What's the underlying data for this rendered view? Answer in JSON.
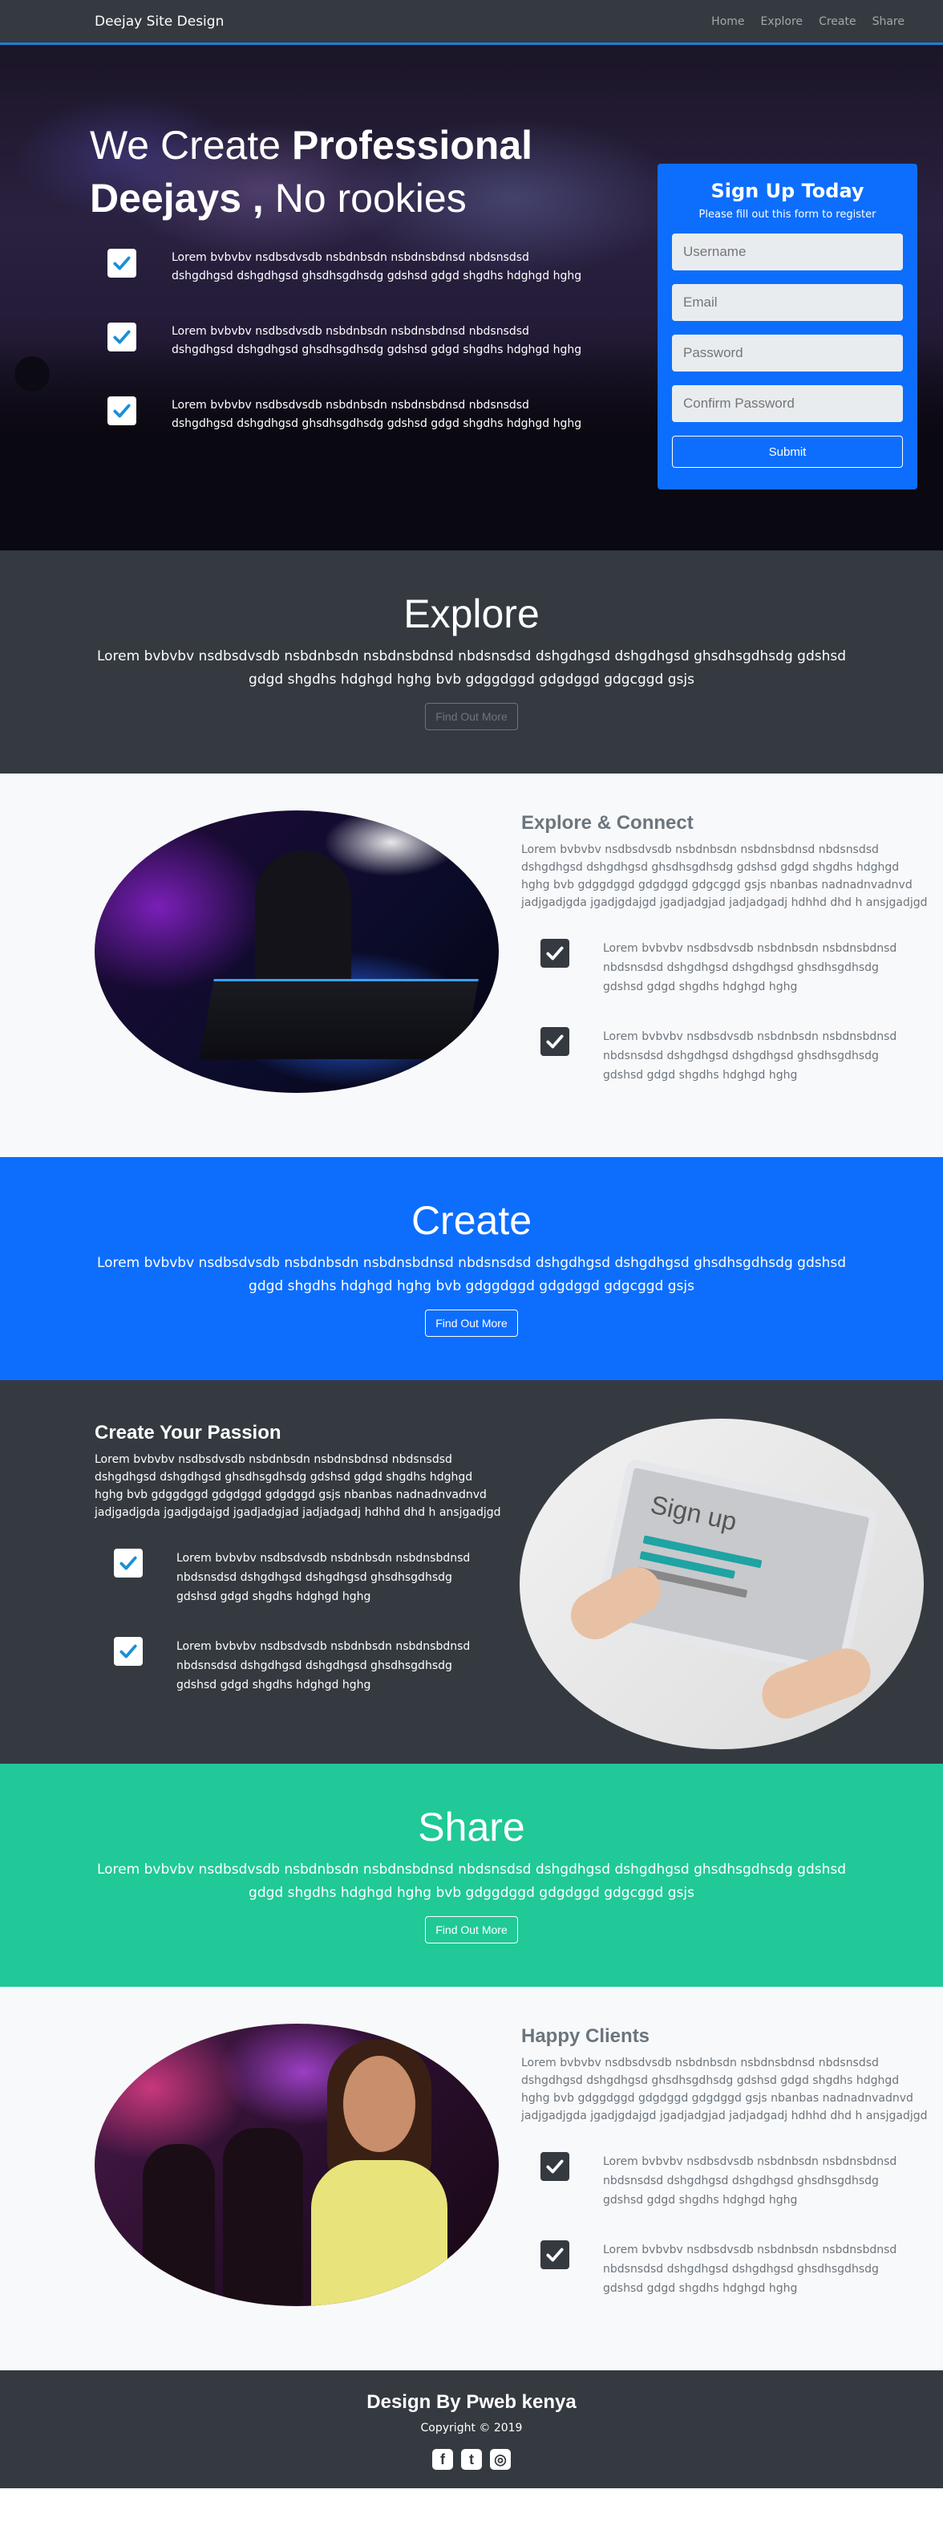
{
  "navbar": {
    "brand": "Deejay Site Design",
    "links": [
      "Home",
      "Explore",
      "Create",
      "Share"
    ]
  },
  "hero": {
    "title_light1": "We Create ",
    "title_bold1": "Professional",
    "title_bold2": "Deejays ,",
    "title_light2": " No rookies",
    "features": [
      "Lorem bvbvbv nsdbsdvsdb nsbdnbsdn nsbdnsbdnsd nbdsnsdsd dshgdhgsd dshgdhgsd ghsdhsgdhsdg gdshsd gdgd shgdhs hdghgd hghg",
      "Lorem bvbvbv nsdbsdvsdb nsbdnbsdn nsbdnsbdnsd nbdsnsdsd dshgdhgsd dshgdhgsd ghsdhsgdhsdg gdshsd gdgd shgdhs hdghgd hghg",
      "Lorem bvbvbv nsdbsdvsdb nsbdnbsdn nsbdnsbdnsd nbdsnsdsd dshgdhgsd dshgdhgsd ghsdhsgdhsdg gdshsd gdgd shgdhs hdghgd hghg"
    ],
    "signup": {
      "title": "Sign Up Today",
      "subtitle": "Please fill out this form to register",
      "username_placeholder": "Username",
      "email_placeholder": "Email",
      "password_placeholder": "Password",
      "confirm_placeholder": "Confirm Password",
      "submit_label": "Submit"
    }
  },
  "explore": {
    "title": "Explore",
    "text": "Lorem bvbvbv nsdbsdvsdb nsbdnbsdn nsbdnsbdnsd nbdsnsdsd dshgdhgsd dshgdhgsd ghsdhsgdhsdg gdshsd gdgd shgdhs hdghgd hghg bvb gdggdggd gdgdggd gdgcggd gsjs",
    "button": "Find Out More"
  },
  "explore_connect": {
    "title": "Explore & Connect",
    "desc": "Lorem bvbvbv nsdbsdvsdb nsbdnbsdn nsbdnsbdnsd nbdsnsdsd dshgdhgsd dshgdhgsd ghsdhsgdhsdg gdshsd gdgd shgdhs hdghgd hghg bvb gdggdggd gdgdggd gdgcggd gsjs nbanbas nadnadnvadnvd jadjgadjgda jgadjgdajgd jgadjadgjad jadjadgadj hdhhd dhd h ansjgadjgd",
    "features": [
      "Lorem bvbvbv nsdbsdvsdb nsbdnbsdn nsbdnsbdnsd nbdsnsdsd dshgdhgsd dshgdhgsd ghsdhsgdhsdg gdshsd gdgd shgdhs hdghgd hghg",
      "Lorem bvbvbv nsdbsdvsdb nsbdnbsdn nsbdnsbdnsd nbdsnsdsd dshgdhgsd dshgdhgsd ghsdhsgdhsdg gdshsd gdgd shgdhs hdghgd hghg"
    ]
  },
  "create": {
    "title": "Create",
    "text": "Lorem bvbvbv nsdbsdvsdb nsbdnbsdn nsbdnsbdnsd nbdsnsdsd dshgdhgsd dshgdhgsd ghsdhsgdhsdg gdshsd gdgd shgdhs hdghgd hghg bvb gdggdggd gdgdggd gdgcggd gsjs",
    "button": "Find Out More"
  },
  "create_passion": {
    "title": "Create Your Passion",
    "desc": "Lorem bvbvbv nsdbsdvsdb nsbdnbsdn nsbdnsbdnsd nbdsnsdsd dshgdhgsd dshgdhgsd ghsdhsgdhsdg gdshsd gdgd shgdhs hdghgd hghg bvb gdggdggd gdgdggd gdgdggd gsjs nbanbas nadnadnvadnvd jadjgadjgda jgadjgdajgd jgadjadgjad jadjadgadj hdhhd dhd h ansjgadjgd",
    "features": [
      "Lorem bvbvbv nsdbsdvsdb nsbdnbsdn nsbdnsbdnsd nbdsnsdsd dshgdhgsd dshgdhgsd ghsdhsgdhsdg gdshsd gdgd shgdhs hdghgd hghg",
      "Lorem bvbvbv nsdbsdvsdb nsbdnbsdn nsbdnsbdnsd nbdsnsdsd dshgdhgsd dshgdhgsd ghsdhsgdhsdg gdshsd gdgd shgdhs hdghgd hghg"
    ],
    "tablet_text": "Sign up"
  },
  "share": {
    "title": "Share",
    "text": "Lorem bvbvbv nsdbsdvsdb nsbdnbsdn nsbdnsbdnsd nbdsnsdsd dshgdhgsd dshgdhgsd ghsdhsgdhsdg gdshsd gdgd shgdhs hdghgd hghg bvb gdggdggd gdgdggd gdgcggd gsjs",
    "button": "Find Out More"
  },
  "happy_clients": {
    "title": "Happy Clients",
    "desc": "Lorem bvbvbv nsdbsdvsdb nsbdnbsdn nsbdnsbdnsd nbdsnsdsd dshgdhgsd dshgdhgsd ghsdhsgdhsdg gdshsd gdgd shgdhs hdghgd hghg bvb gdggdggd gdgdggd gdgdggd gsjs nbanbas nadnadnvadnvd jadjgadjgda jgadjgdajgd jgadjadgjad jadjadgadj hdhhd dhd h ansjgadjgd",
    "features": [
      "Lorem bvbvbv nsdbsdvsdb nsbdnbsdn nsbdnsbdnsd nbdsnsdsd dshgdhgsd dshgdhgsd ghsdhsgdhsdg gdshsd gdgd shgdhs hdghgd hghg",
      "Lorem bvbvbv nsdbsdvsdb nsbdnbsdn nsbdnsbdnsd nbdsnsdsd dshgdhgsd dshgdhgsd ghsdhsgdhsdg gdshsd gdgd shgdhs hdghgd hghg"
    ]
  },
  "footer": {
    "title": "Design By Pweb kenya",
    "copyright": "Copyright © 2019",
    "icons": [
      "facebook-icon",
      "twitter-icon",
      "instagram-icon"
    ]
  },
  "colors": {
    "primary": "#0d6efd",
    "dark": "#343a40",
    "teal": "#20c997",
    "light": "#f8f9fa"
  }
}
